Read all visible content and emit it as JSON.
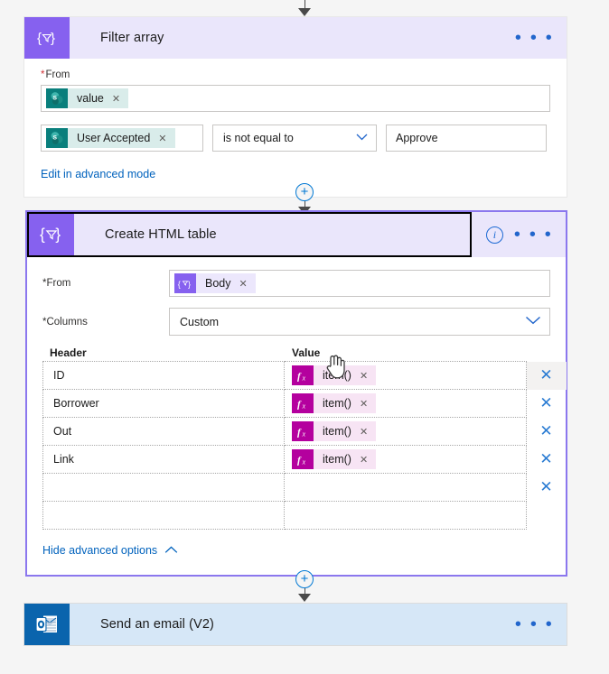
{
  "flow": {
    "filter_array": {
      "icon": "filter-array-icon",
      "title": "Filter array",
      "menu": "• • •",
      "from_label": "From",
      "from_required": "*",
      "from_token": {
        "icon": "sharepoint-icon",
        "text": "value",
        "remove": "✕"
      },
      "condition_left_token": {
        "icon": "sharepoint-icon",
        "text": "User Accepted",
        "remove": "✕"
      },
      "condition_operator": "is not equal to",
      "condition_operator_chevron": "⌄",
      "condition_value": "Approve",
      "advanced_link": "Edit in advanced mode"
    },
    "create_html_table": {
      "icon": "filter-array-icon",
      "title": "Create HTML table",
      "info": "i",
      "menu": "• • •",
      "from_label": "From",
      "from_required": "*",
      "from_token": {
        "icon": "compose-icon",
        "text": "Body",
        "remove": "✕"
      },
      "columns_label": "Columns",
      "columns_required": "*",
      "columns_value": "Custom",
      "columns_chevron": "⌄",
      "table": {
        "header_col_label": "Header",
        "value_col_label": "Value",
        "rows": [
          {
            "header": "ID",
            "value_token": {
              "icon": "fx-icon",
              "text": "item()",
              "remove": "✕"
            },
            "delete": "✕",
            "delete_hover": true
          },
          {
            "header": "Borrower",
            "value_token": {
              "icon": "fx-icon",
              "text": "item()",
              "remove": "✕"
            },
            "delete": "✕",
            "delete_hover": false
          },
          {
            "header": "Out",
            "value_token": {
              "icon": "fx-icon",
              "text": "item()",
              "remove": "✕"
            },
            "delete": "✕",
            "delete_hover": false
          },
          {
            "header": "Link",
            "value_token": {
              "icon": "fx-icon",
              "text": "item()",
              "remove": "✕"
            },
            "delete": "✕",
            "delete_hover": false
          },
          {
            "header": "",
            "value_token": null,
            "delete": "✕",
            "delete_hover": false
          },
          {
            "header": "",
            "value_token": null,
            "delete": "",
            "delete_hover": false
          }
        ]
      },
      "advanced_link": "Hide advanced options",
      "advanced_chevron": "⌃"
    },
    "send_email": {
      "icon": "outlook-icon",
      "title": "Send an email (V2)",
      "menu": "• • •"
    },
    "connectors": {
      "plus": "+",
      "arrow": "arrow-down-icon"
    }
  },
  "colors": {
    "accent_purple": "#8661ef",
    "card_header_purple": "#eae6fb",
    "sharepoint_teal": "#0a7f7c",
    "fx_magenta": "#b4009e",
    "outlook_blue": "#0a64ad",
    "link_blue": "#0062bd",
    "required_red": "#d13438",
    "email_header_blue": "#d6e7f7"
  }
}
